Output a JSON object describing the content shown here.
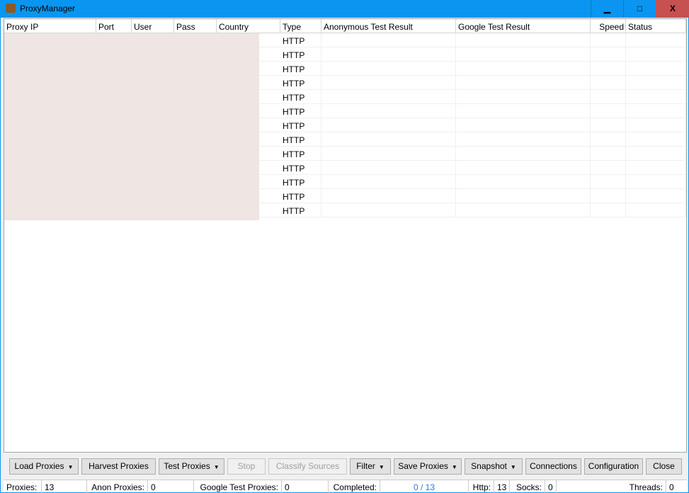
{
  "window": {
    "title": "ProxyManager",
    "minimize": "▁",
    "maximize": "□",
    "close": "X"
  },
  "table": {
    "columns": [
      "Proxy IP",
      "Port",
      "User",
      "Pass",
      "Country",
      "Type",
      "Anonymous Test Result",
      "Google Test Result",
      "Speed",
      "Status"
    ],
    "rows": [
      {
        "type": "HTTP"
      },
      {
        "type": "HTTP"
      },
      {
        "type": "HTTP"
      },
      {
        "type": "HTTP"
      },
      {
        "type": "HTTP"
      },
      {
        "type": "HTTP"
      },
      {
        "type": "HTTP"
      },
      {
        "type": "HTTP"
      },
      {
        "type": "HTTP"
      },
      {
        "type": "HTTP"
      },
      {
        "type": "HTTP"
      },
      {
        "type": "HTTP"
      },
      {
        "type": "HTTP"
      }
    ]
  },
  "toolbar": {
    "load": "Load Proxies",
    "harvest": "Harvest Proxies",
    "test": "Test Proxies",
    "stop": "Stop",
    "classify": "Classify Sources",
    "filter": "Filter",
    "save": "Save Proxies",
    "snapshot": "Snapshot",
    "connections": "Connections",
    "configuration": "Configuration",
    "close": "Close",
    "dropdown_arrow": "▼"
  },
  "status": {
    "proxies_label": "Proxies:",
    "proxies": "13",
    "anon_label": "Anon Proxies:",
    "anon": "0",
    "google_label": "Google Test Proxies:",
    "google": "0",
    "completed_label": "Completed:",
    "completed": "0 / 13",
    "http_label": "Http:",
    "http": "13",
    "socks_label": "Socks:",
    "socks": "0",
    "threads_label": "Threads:",
    "threads": "0"
  },
  "colors": {
    "titlebar": "#0a96f0",
    "close_button": "#c75050",
    "completed_text": "#1e7fd8"
  }
}
